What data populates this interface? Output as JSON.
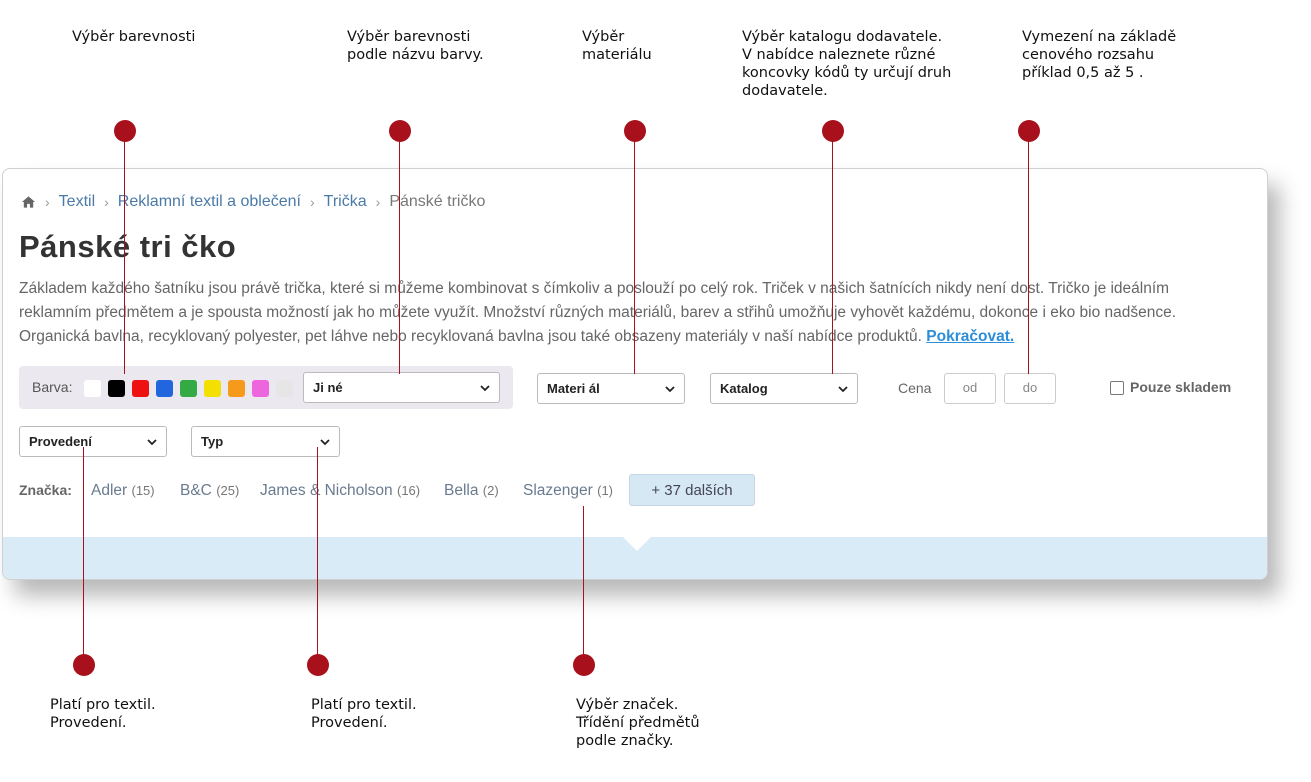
{
  "annotations": {
    "top": [
      "Výběr barevnosti",
      "Výběr barevnosti\npodle názvu barvy.",
      "Výběr\nmateriálu",
      "Výběr katalogu dodavatele.\nV nabídce naleznete různé\nkoncovky kódů ty určují druh\ndodavatele.",
      "Vymezení na základě\ncenového rozsahu\npříklad 0,5 až 5 ."
    ],
    "bottom": [
      "Platí pro textil.\nProvedení.",
      "Platí pro textil.\nProvedení.",
      "Výběr značek.\nTřídění předmětů\npodle značky."
    ],
    "marker_color": "#a8111c"
  },
  "breadcrumb": {
    "home_icon": "home-icon",
    "items": [
      "Textil",
      "Reklamní textil a oblečení",
      "Trička"
    ],
    "current": "Pánské tričko"
  },
  "page": {
    "title": "Pánské tri čko",
    "description": "Základem každého šatníku jsou právě trička, které si můžeme kombinovat s čímkoliv a poslouží po celý rok. Triček v našich šatnících nikdy není dost. Tričko je ideálním reklamním předmětem a je spousta možností jak ho můžete využít. Množství různých materiálů, barev a střihů umožňuje vyhovět každému, dokonce i eko bio nadšence. Organická bavlna, recyklovaný polyester, pet láhve nebo recyklovaná bavlna jsou také obsazeny materiály v naší nabídce produktů.",
    "more_link": "Pokračovat."
  },
  "filters": {
    "color_label": "Barva:",
    "swatches": [
      "#ffffff",
      "#000000",
      "#ee1111",
      "#2266dd",
      "#33aa44",
      "#f3e000",
      "#f59a1a",
      "#ee66dd",
      "#e6e6e6"
    ],
    "color_select": "Ji né",
    "material_select": "Materi ál",
    "catalog_select": "Katalog",
    "price_label": "Cena",
    "price_from_placeholder": "od",
    "price_to_placeholder": "do",
    "stock_label": "Pouze skladem",
    "finish_select": "Provedení",
    "type_select": "Typ"
  },
  "brands": {
    "label": "Značka:",
    "items": [
      {
        "name": "Adler",
        "count": "(15)"
      },
      {
        "name": "B&C",
        "count": "(25)"
      },
      {
        "name": "James & Nicholson",
        "count": "(16)"
      },
      {
        "name": "Bella",
        "count": "(2)"
      },
      {
        "name": "Slazenger",
        "count": "(1)"
      }
    ],
    "more": "+ 37 dalších"
  },
  "colors": {
    "link": "#4a7aa8",
    "accent_link": "#2c8ed8",
    "footer_band": "#d9ebf7"
  }
}
